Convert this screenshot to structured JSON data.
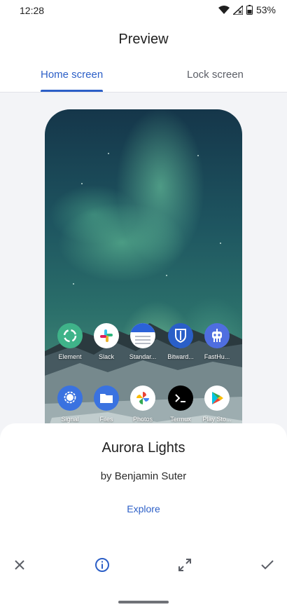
{
  "status": {
    "time": "12:28",
    "battery": "53%"
  },
  "header": {
    "title": "Preview"
  },
  "tabs": [
    {
      "label": "Home screen",
      "selected": true
    },
    {
      "label": "Lock screen",
      "selected": false
    }
  ],
  "preview": {
    "row1": [
      {
        "label": "Element",
        "icon": "element-icon",
        "color": "#3fb389"
      },
      {
        "label": "Slack",
        "icon": "slack-icon",
        "color": "#ffffff"
      },
      {
        "label": "Standar...",
        "icon": "notes-icon",
        "color": "#ffffff"
      },
      {
        "label": "Bitward...",
        "icon": "bitwarden-icon",
        "color": "#2a5fc8"
      },
      {
        "label": "FastHu...",
        "icon": "robot-icon",
        "color": "#4f6ee0"
      }
    ],
    "row2": [
      {
        "label": "Signal",
        "icon": "signal-icon",
        "color": "#3a72e0"
      },
      {
        "label": "Files",
        "icon": "folder-icon",
        "color": "#3a72e0"
      },
      {
        "label": "Photos",
        "icon": "pinwheel-icon",
        "color": "#ffffff"
      },
      {
        "label": "Termux",
        "icon": "terminal-icon",
        "color": "#000000"
      },
      {
        "label": "Play Sto...",
        "icon": "play-icon",
        "color": "#ffffff"
      }
    ]
  },
  "wallpaper": {
    "title": "Aurora Lights",
    "author": "by Benjamin Suter",
    "explore_label": "Explore"
  },
  "actions": [
    "close-icon",
    "info-icon",
    "fullscreen-icon",
    "check-icon"
  ],
  "colors": {
    "accent": "#2c5fc7"
  }
}
